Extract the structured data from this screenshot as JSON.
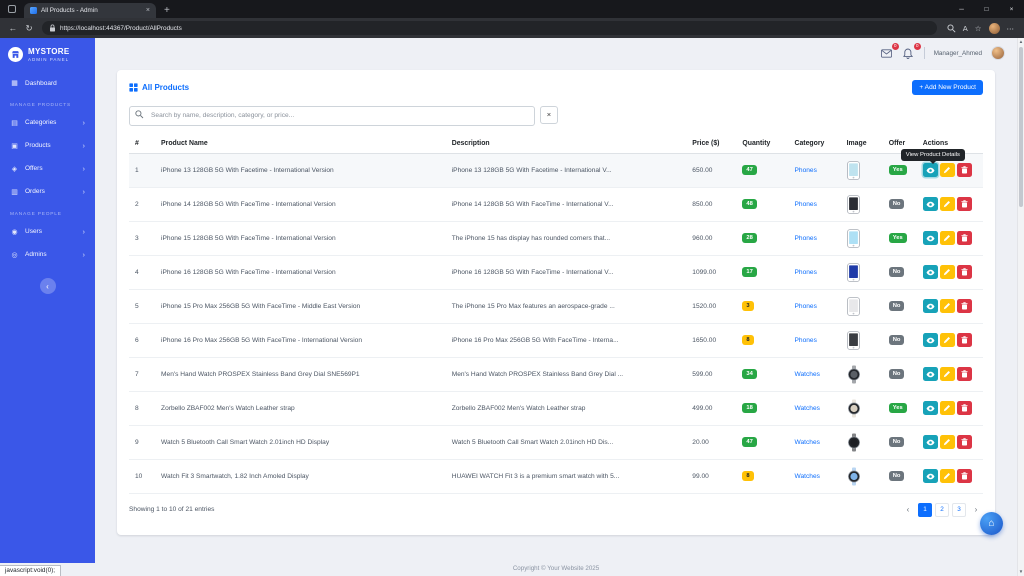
{
  "browser": {
    "tab_title": "All Products - Admin",
    "url": "https://localhost:44367/Product/AllProducts",
    "status_text": "javascript:void(0);"
  },
  "colors": {
    "primary": "#0d6efd",
    "sidebar": "#3a57e8",
    "success": "#28a745",
    "warning": "#ffc107",
    "danger": "#dc3545",
    "info": "#17a2b8",
    "secondary": "#6c757d"
  },
  "sidebar": {
    "brand_name": "MYSTORE",
    "brand_subtitle": "ADMIN PANEL",
    "dashboard_label": "Dashboard",
    "sections": [
      {
        "label": "MANAGE PRODUCTS",
        "items": [
          {
            "id": "categories",
            "label": "Categories"
          },
          {
            "id": "products",
            "label": "Products"
          },
          {
            "id": "offers",
            "label": "Offers"
          },
          {
            "id": "orders",
            "label": "Orders"
          }
        ]
      },
      {
        "label": "MANAGE PEOPLE",
        "items": [
          {
            "id": "users",
            "label": "Users"
          },
          {
            "id": "admins",
            "label": "Admins"
          }
        ]
      }
    ]
  },
  "topbar": {
    "user_name": "Manager_Ahmed",
    "badges": [
      {
        "id": "messages",
        "count": "0"
      },
      {
        "id": "notifications",
        "count": "0"
      }
    ]
  },
  "page": {
    "title": "All Products",
    "add_button_label": "+ Add New Product",
    "search_placeholder": "Search by name, description, category, or price...",
    "tooltip": "View Product Details",
    "columns": [
      "#",
      "Product Name",
      "Description",
      "Price ($)",
      "Quantity",
      "Category",
      "Image",
      "Offer",
      "Actions"
    ],
    "products": [
      {
        "num": "1",
        "name": "iPhone 13 128GB 5G With Facetime - International Version",
        "description": "iPhone 13 128GB 5G With Facetime - International V...",
        "price": "650.00",
        "quantity": "47",
        "quantity_level": "success",
        "category": "Phones",
        "image_type": "phone",
        "image_color": "#bfe3ef",
        "offer": "Yes"
      },
      {
        "num": "2",
        "name": "iPhone 14 128GB 5G With FaceTime - International Version",
        "description": "iPhone 14 128GB 5G With FaceTime - International V...",
        "price": "850.00",
        "quantity": "48",
        "quantity_level": "success",
        "category": "Phones",
        "image_type": "phone",
        "image_color": "#2a2d34",
        "offer": "No"
      },
      {
        "num": "3",
        "name": "iPhone 15 128GB 5G With FaceTime - International Version",
        "description": "The iPhone 15 has display has rounded corners that...",
        "price": "960.00",
        "quantity": "28",
        "quantity_level": "success",
        "category": "Phones",
        "image_type": "phone",
        "image_color": "#aee0f5",
        "offer": "Yes"
      },
      {
        "num": "4",
        "name": "iPhone 16 128GB 5G With FaceTime - International Version",
        "description": "iPhone 16 128GB 5G With FaceTime - International V...",
        "price": "1099.00",
        "quantity": "17",
        "quantity_level": "success",
        "category": "Phones",
        "image_type": "phone",
        "image_color": "#1f3aa8",
        "offer": "No"
      },
      {
        "num": "5",
        "name": "iPhone 15 Pro Max 256GB 5G With FaceTime - Middle East Version",
        "description": "The iPhone 15 Pro Max features an aerospace-grade ...",
        "price": "1520.00",
        "quantity": "3",
        "quantity_level": "warning",
        "category": "Phones",
        "image_type": "phone",
        "image_color": "#e8e8ea",
        "offer": "No"
      },
      {
        "num": "6",
        "name": "iPhone 16 Pro Max 256GB 5G With FaceTime - International Version",
        "description": "iPhone 16 Pro Max 256GB 5G With FaceTime - Interna...",
        "price": "1650.00",
        "quantity": "8",
        "quantity_level": "warning",
        "category": "Phones",
        "image_type": "phone",
        "image_color": "#3a3d42",
        "offer": "No"
      },
      {
        "num": "7",
        "name": "Men's Hand Watch PROSPEX Stainless Band Grey Dial SNE569P1",
        "description": "Men's Hand Watch PROSPEX Stainless Band Grey Dial ...",
        "price": "599.00",
        "quantity": "34",
        "quantity_level": "success",
        "category": "Watches",
        "image_type": "watch",
        "image_color": "#5a5f66",
        "offer": "No"
      },
      {
        "num": "8",
        "name": "Zorbello ZBAF002 Men's Watch Leather strap",
        "description": "Zorbello ZBAF002 Men's Watch Leather strap",
        "price": "499.00",
        "quantity": "18",
        "quantity_level": "success",
        "category": "Watches",
        "image_type": "watch",
        "image_color": "#d8cfc0",
        "offer": "Yes"
      },
      {
        "num": "9",
        "name": "Watch 5 Bluetooth Call Smart Watch 2.01inch HD Display",
        "description": "Watch 5 Bluetooth Call Smart Watch 2.01inch HD Dis...",
        "price": "20.00",
        "quantity": "47",
        "quantity_level": "success",
        "category": "Watches",
        "image_type": "watch",
        "image_color": "#1d1f24",
        "offer": "No"
      },
      {
        "num": "10",
        "name": "Watch Fit 3 Smartwatch, 1.82 Inch Amoled Display",
        "description": "HUAWEI WATCH Fit 3 is a premium smart watch with 5...",
        "price": "99.00",
        "quantity": "8",
        "quantity_level": "warning",
        "category": "Watches",
        "image_type": "watch",
        "image_color": "#7fb3e8",
        "offer": "No"
      }
    ],
    "entries_info": "Showing 1 to 10 of 21 entries",
    "pagination": {
      "pages": [
        "1",
        "2",
        "3"
      ],
      "active": "1"
    },
    "copyright": "Copyright © Your Website 2025"
  }
}
